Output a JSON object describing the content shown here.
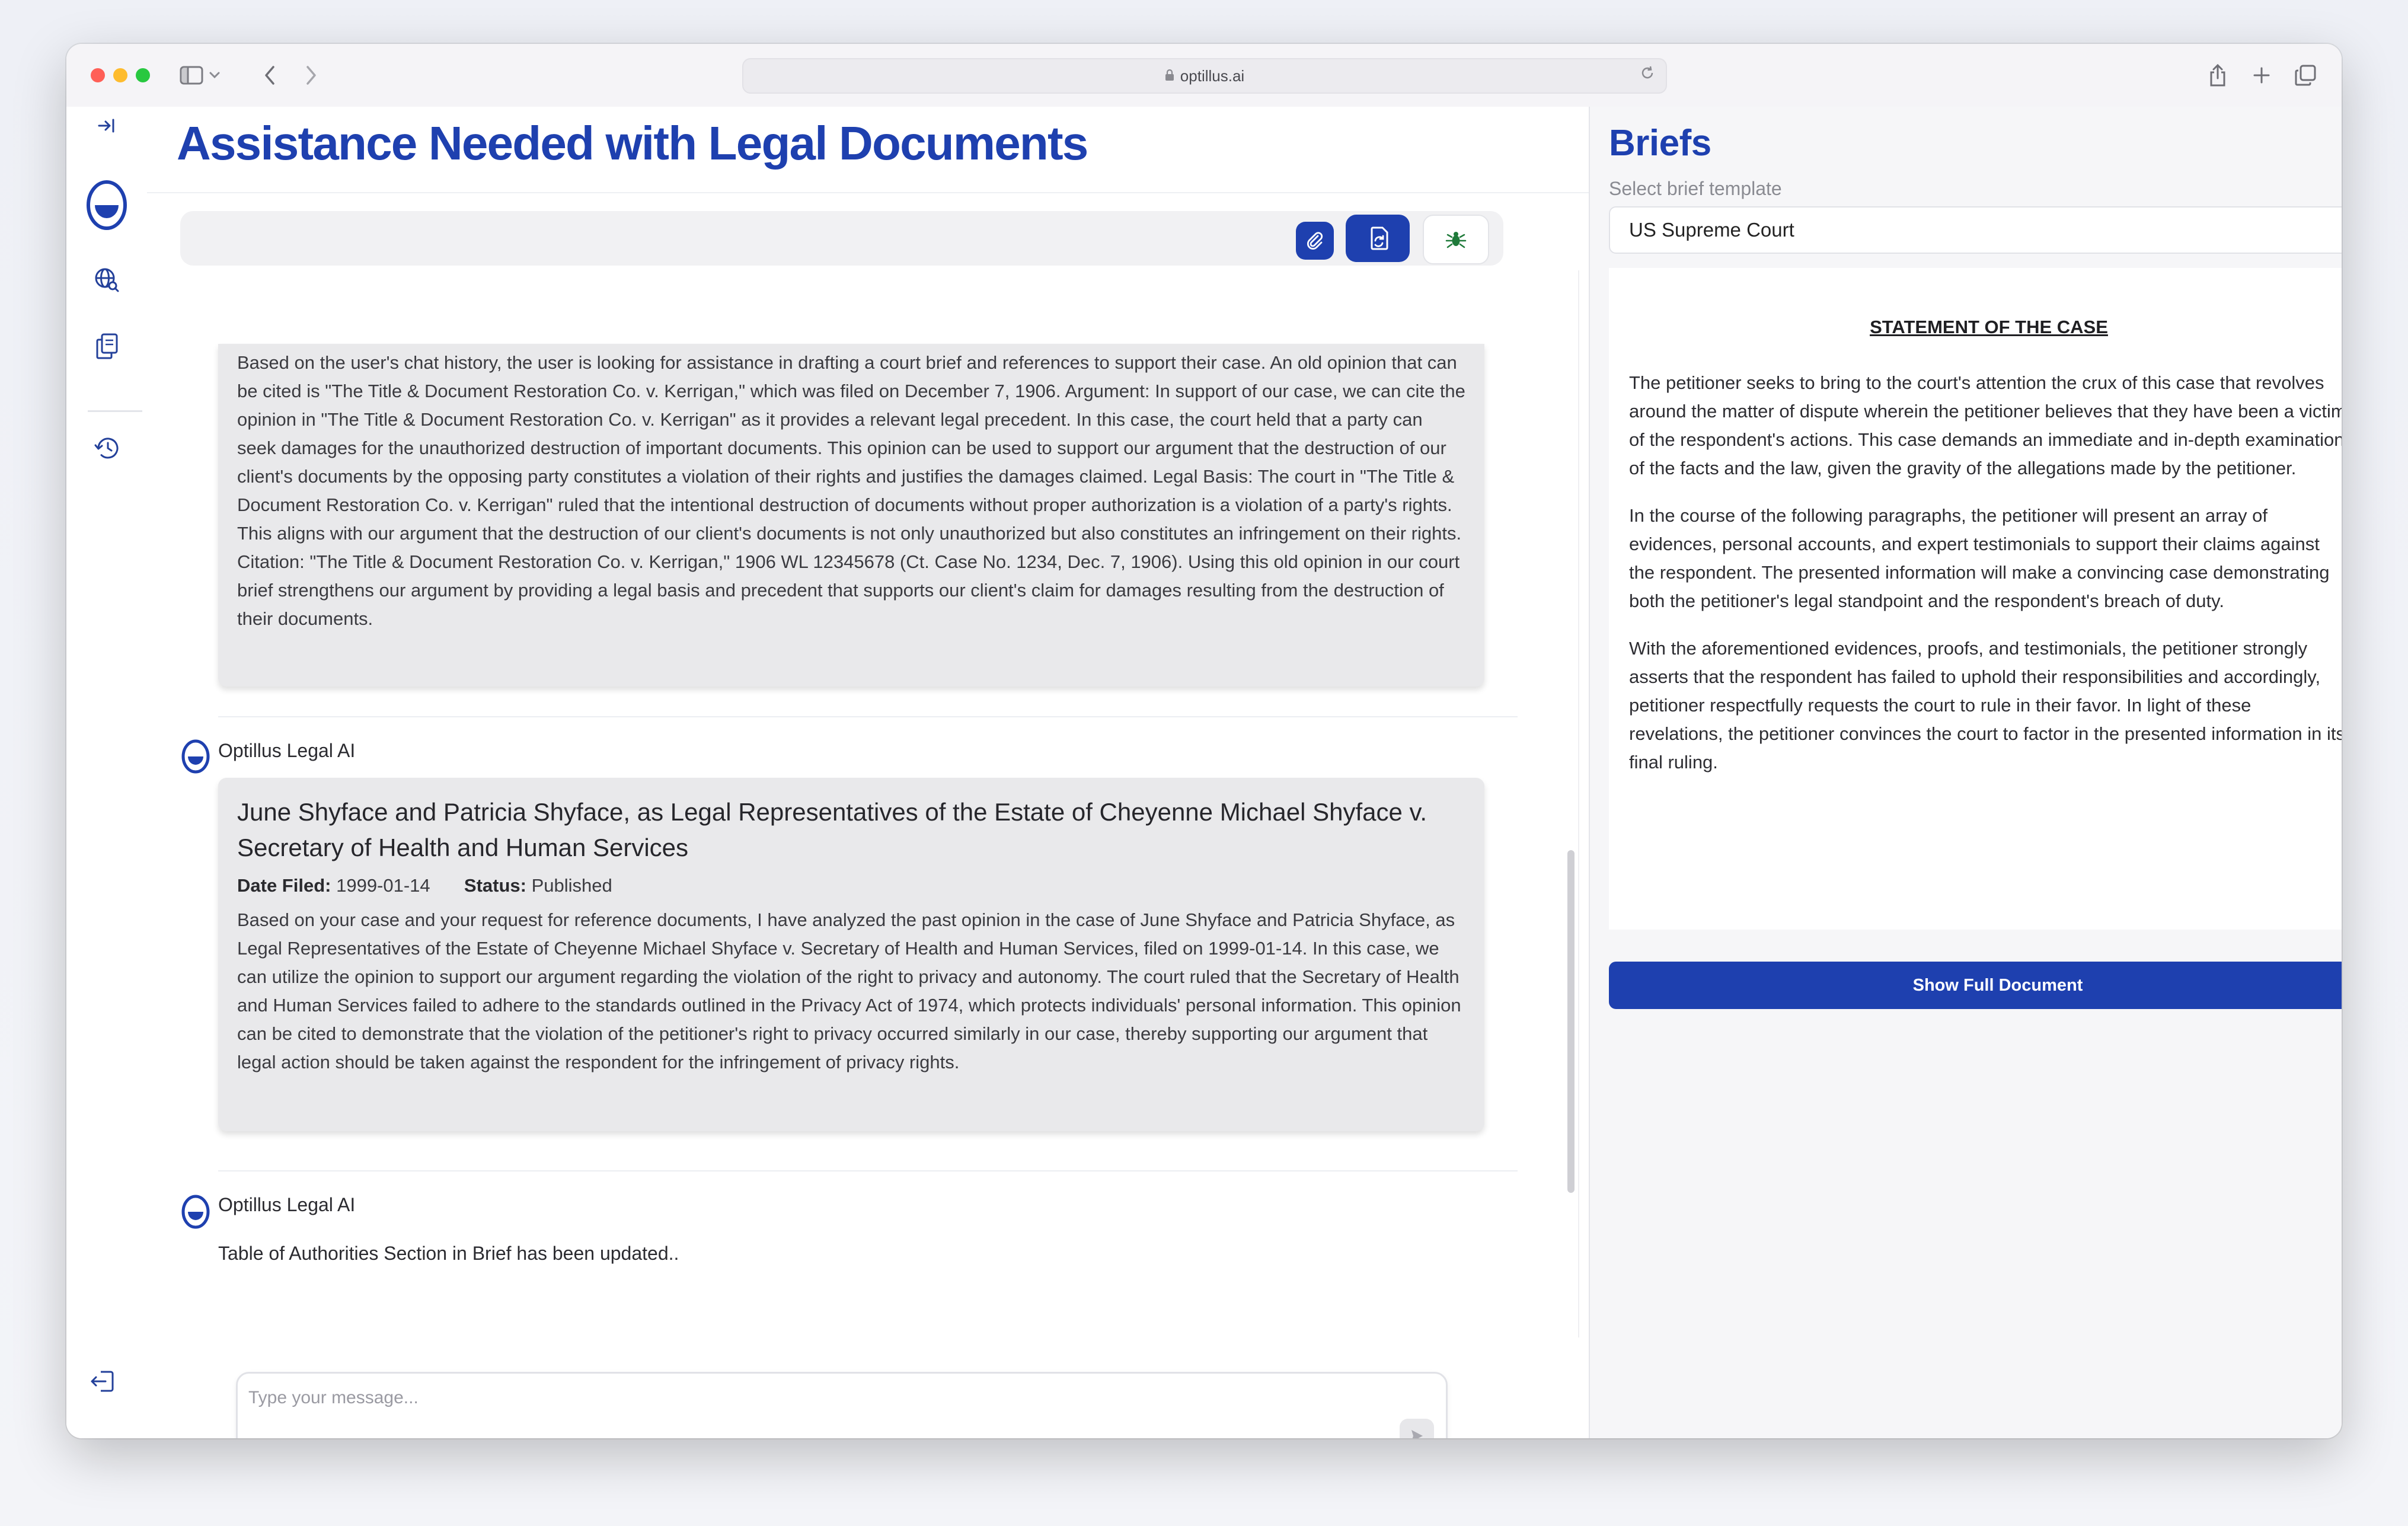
{
  "browser": {
    "url": "optillus.ai"
  },
  "chat": {
    "title": "Assistance Needed with Legal Documents",
    "messages": [
      {
        "text": "Based on the user's chat history, the user is looking for assistance in drafting a court brief and references to support their case. An old opinion that can be cited is \"The Title & Document Restoration Co. v. Kerrigan,\" which was filed on December 7, 1906. Argument: In support of our case, we can cite the opinion in \"The Title & Document Restoration Co. v. Kerrigan\" as it provides a relevant legal precedent. In this case, the court held that a party can seek damages for the unauthorized destruction of important documents. This opinion can be used to support our argument that the destruction of our client's documents by the opposing party constitutes a violation of their rights and justifies the damages claimed. Legal Basis: The court in \"The Title & Document Restoration Co. v. Kerrigan\" ruled that the intentional destruction of documents without proper authorization is a violation of a party's rights. This aligns with our argument that the destruction of our client's documents is not only unauthorized but also constitutes an infringement on their rights. Citation: \"The Title & Document Restoration Co. v. Kerrigan,\" 1906 WL 12345678 (Ct. Case No. 1234, Dec. 7, 1906). Using this old opinion in our court brief strengthens our argument by providing a legal basis and precedent that supports our client's claim for damages resulting from the destruction of their documents."
      },
      {
        "author": "Optillus Legal AI",
        "case_title": "June Shyface and Patricia Shyface, as Legal Representatives of the Estate of Cheyenne Michael Shyface v. Secretary of Health and Human Services",
        "date_label": "Date Filed:",
        "date_value": "1999-01-14",
        "status_label": "Status:",
        "status_value": "Published",
        "text": "Based on your case and your request for reference documents, I have analyzed the past opinion in the case of June Shyface and Patricia Shyface, as Legal Representatives of the Estate of Cheyenne Michael Shyface v. Secretary of Health and Human Services, filed on 1999-01-14. In this case, we can utilize the opinion to support our argument regarding the violation of the right to privacy and autonomy. The court ruled that the Secretary of Health and Human Services failed to adhere to the standards outlined in the Privacy Act of 1974, which protects individuals' personal information. This opinion can be cited to demonstrate that the violation of the petitioner's right to privacy occurred similarly in our case, thereby supporting our argument that legal action should be taken against the respondent for the infringement of privacy rights."
      },
      {
        "author": "Optillus Legal AI",
        "text": "Table of Authorities Section in Brief has been updated.."
      }
    ],
    "composer": {
      "placeholder": "Type your message..."
    }
  },
  "briefs": {
    "title": "Briefs",
    "subtitle": "Select brief template",
    "template": "US Supreme Court",
    "heading": "STATEMENT OF THE CASE",
    "paragraphs": [
      "The petitioner seeks to bring to the court's attention the crux of this case that revolves around the matter of dispute wherein the petitioner believes that they have been a victim of the respondent's actions. This case demands an immediate and in-depth examination of the facts and the law, given the gravity of the allegations made by the petitioner.",
      "In the course of the following paragraphs, the petitioner will present an array of evidences, personal accounts, and expert testimonials to support their claims against the respondent. The presented information will make a convincing case demonstrating both the petitioner's legal standpoint and the respondent's breach of duty.",
      "With the aforementioned evidences, proofs, and testimonials, the petitioner strongly asserts that the respondent has failed to uphold their responsibilities and accordingly, petitioner respectfully requests the court to rule in their favor. In light of these revelations, the petitioner convinces the court to factor in the presented information in its final ruling."
    ],
    "show_full_label": "Show Full Document"
  },
  "colors": {
    "brand": "#1e40af",
    "message_bg": "#e9e9eb",
    "panel_bg": "#f6f6f8"
  },
  "icons": {
    "rail": [
      "expand-sidebar-icon",
      "optillus-logo-icon",
      "globe-search-icon",
      "documents-icon",
      "history-icon",
      "logout-icon"
    ],
    "toolbar": [
      "paperclip-icon",
      "document-sync-icon",
      "bug-icon"
    ]
  }
}
